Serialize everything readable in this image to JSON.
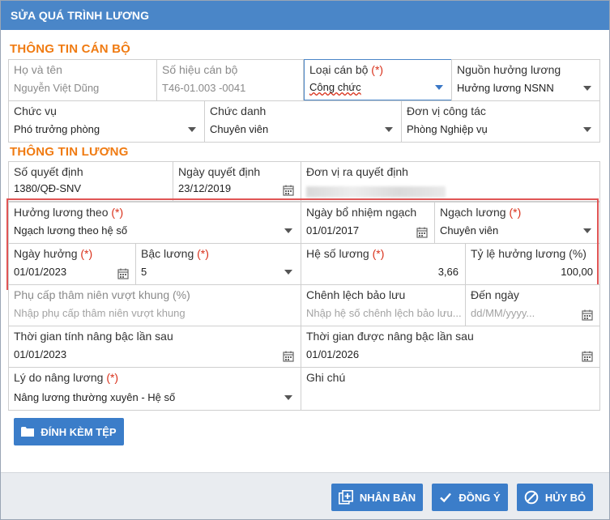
{
  "dialog": {
    "title": "SỬA QUÁ TRÌNH LƯƠNG"
  },
  "sections": {
    "staff": "THÔNG TIN CÁN BỘ",
    "salary": "THÔNG TIN LƯƠNG"
  },
  "required_mark": "(*)",
  "staff": {
    "name": {
      "label": "Họ và tên",
      "value": "Nguyễn Việt Dũng"
    },
    "code": {
      "label": "Số hiệu cán bộ",
      "value": "T46-01.003 -0041"
    },
    "type": {
      "label": "Loại cán bộ",
      "value": "Công chức"
    },
    "source": {
      "label": "Nguồn hưởng lương",
      "value": "Hưởng lương NSNN"
    },
    "position": {
      "label": "Chức vụ",
      "value": "Phó trưởng phòng"
    },
    "title": {
      "label": "Chức danh",
      "value": "Chuyên viên"
    },
    "unit": {
      "label": "Đơn vị công tác",
      "value": "Phòng Nghiệp vụ"
    }
  },
  "salary": {
    "decision_no": {
      "label": "Số quyết định",
      "value": "1380/QĐ-SNV"
    },
    "decision_date": {
      "label": "Ngày quyết định",
      "value": "23/12/2019"
    },
    "issuer": {
      "label": "Đơn vị ra quyết định"
    },
    "salary_by": {
      "label": "Hưởng lương theo",
      "value": "Ngạch lương theo hệ số"
    },
    "appoint_date": {
      "label": "Ngày bổ nhiệm ngạch",
      "value": "01/01/2017"
    },
    "grade": {
      "label": "Ngạch lương",
      "value": "Chuyên viên"
    },
    "effective_date": {
      "label": "Ngày hưởng",
      "value": "01/01/2023"
    },
    "step": {
      "label": "Bậc lương",
      "value": "5"
    },
    "coefficient": {
      "label": "Hệ số lương",
      "value": "3,66"
    },
    "rate": {
      "label": "Tỷ lệ hưởng lương (%)",
      "value": "100,00"
    },
    "seniority": {
      "label": "Phụ cấp thâm niên vượt khung (%)",
      "placeholder": "Nhập phụ cấp thâm niên vượt khung"
    },
    "reserve": {
      "label": "Chênh lệch bảo lưu",
      "placeholder": "Nhập hệ số chênh lệch bảo lưu..."
    },
    "until": {
      "label": "Đến ngày",
      "placeholder": "dd/MM/yyyy..."
    },
    "next_raise": {
      "label": "Thời gian tính nâng bậc lần sau",
      "value": "01/01/2023"
    },
    "raised_next": {
      "label": "Thời gian được nâng bậc lần sau",
      "value": "01/01/2026"
    },
    "reason": {
      "label": "Lý do nâng lương",
      "value": "Nâng lương thường xuyên - Hệ số"
    },
    "note": {
      "label": "Ghi chú"
    }
  },
  "attach_button": "ĐÍNH KÈM TỆP",
  "footer": {
    "duplicate": "NHÂN BẢN",
    "agree": "ĐỒNG Ý",
    "cancel": "HỦY BỎ"
  },
  "colors": {
    "header": "#4a86c8",
    "section": "#f07b12",
    "required": "#d9301a",
    "button": "#3b7dc9",
    "highlight": "#e05555"
  }
}
